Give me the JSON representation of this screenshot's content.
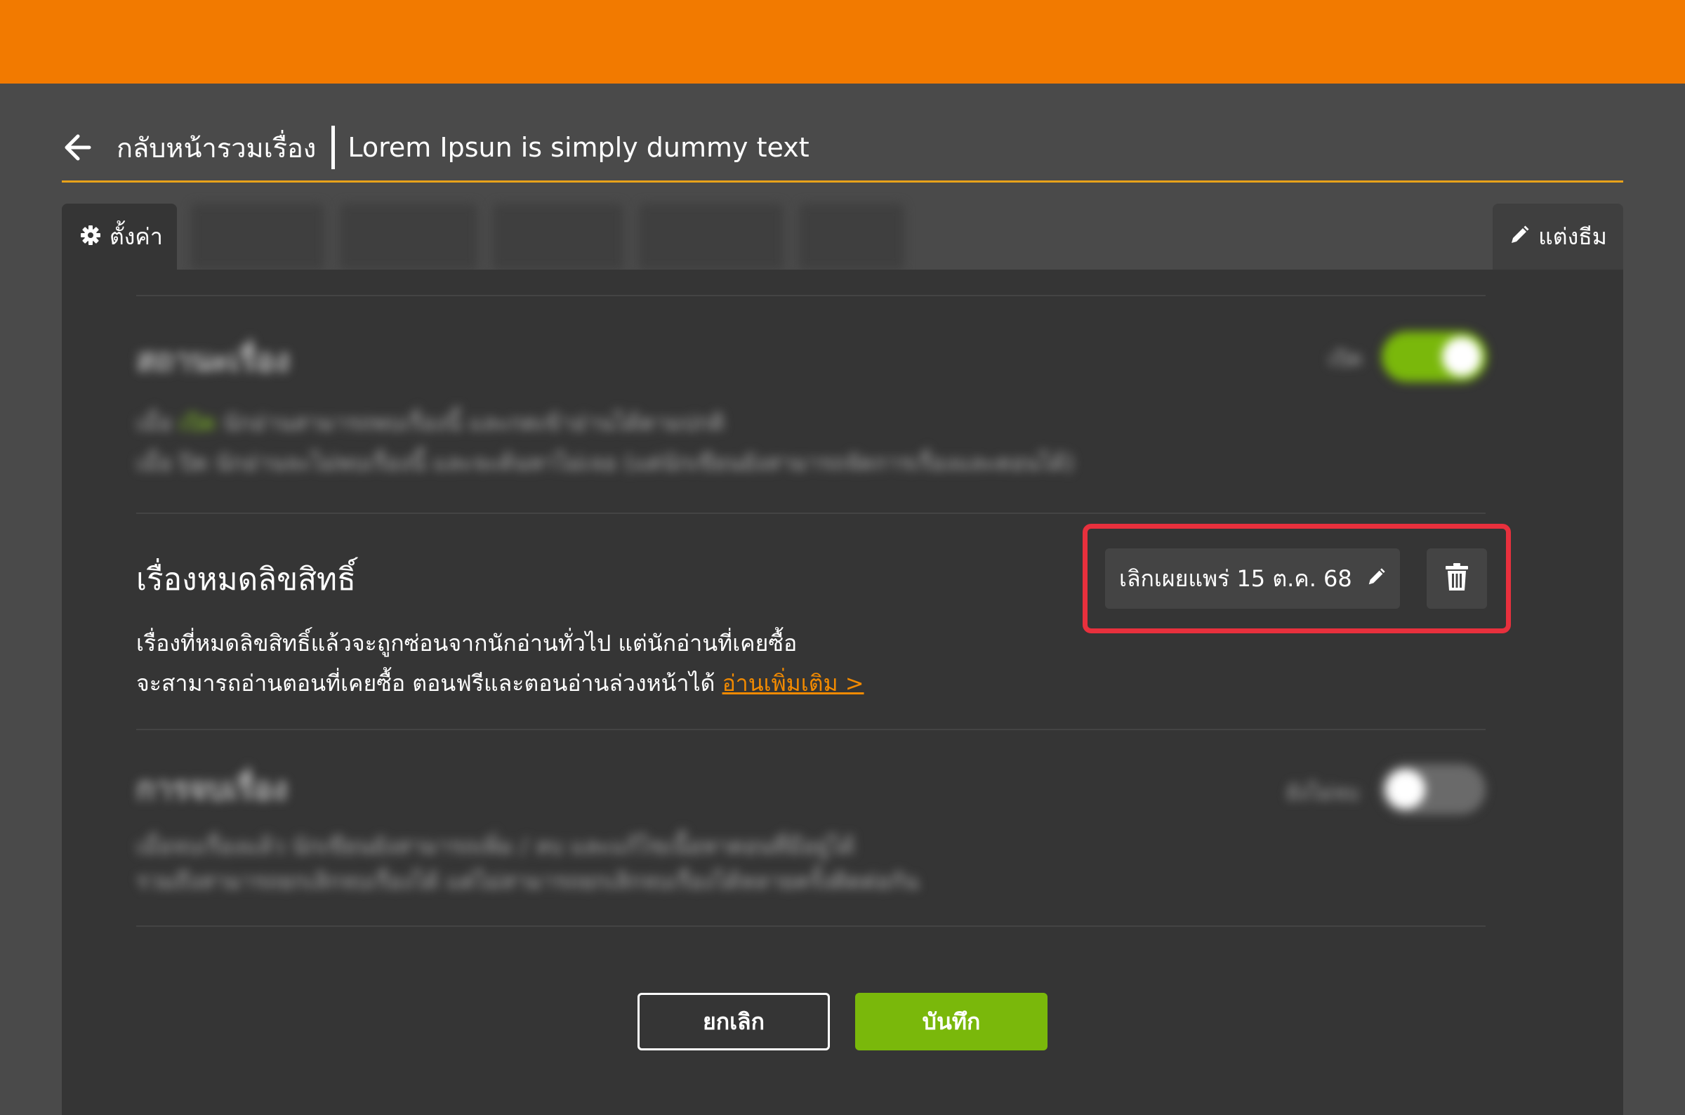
{
  "header": {
    "back_label": "กลับหน้ารวมเรื่อง",
    "title": "Lorem Ipsun is simply dummy text"
  },
  "tabs": {
    "settings_label": "ตั้งค่า",
    "theme_label": "แต่งธีม"
  },
  "sections": {
    "status": {
      "title": "สถานะเรื่อง",
      "toggle_label": "เปิด",
      "toggle_on": true,
      "desc_line1_prefix": "เมื่อ",
      "desc_line1_green": "เปิด",
      "desc_line1_rest": "นักอ่านสามารถพบเรื่องนี้ และกดเข้าอ่านได้ตามปกติ",
      "desc_line2": "เมื่อ ปิด นักอ่านจะไม่พบเรื่องนี้ และจะค้นหาไม่เจอ (แต่นักเขียนยังสามารถจัดการเรื่องและตอนได้)"
    },
    "copyright": {
      "title": "เรื่องหมดลิขสิทธิ์",
      "desc_line1": "เรื่องที่หมดลิขสิทธิ์แล้วจะถูกซ่อนจากนักอ่านทั่วไป แต่นักอ่านที่เคยซื้อ",
      "desc_line2": "จะสามารถอ่านตอนที่เคยซื้อ ตอนฟรีและตอนอ่านล่วงหน้าได้",
      "link": "อ่านเพิ่มเติม >",
      "date_value": "เลิกเผยแพร่ 15 ต.ค. 68"
    },
    "ending": {
      "title": "การจบเรื่อง",
      "toggle_label": "ยังไม่จบ",
      "toggle_on": false,
      "desc_line1": "เมื่อจบเรื่องแล้ว นักเขียนยังสามารถเพิ่ม / ลบ และแก้ไขเนื้อหาตอนที่มีอยู่ได้",
      "desc_line2": "รวมถึงสามารถยกเลิกจบเรื่องได้ แต่ไม่สามารถยกเลิกจบเรื่องได้หลายครั้งติดต่อกัน"
    }
  },
  "buttons": {
    "cancel": "ยกเลิก",
    "save": "บันทึก"
  },
  "colors": {
    "topbar": "#f27a00",
    "accent_line": "#e8a21a",
    "toggle_on": "#7ab80b",
    "highlight": "#e8303d",
    "link": "#f28a00"
  },
  "icons": [
    "back-arrow-icon",
    "gear-icon",
    "pencil-icon",
    "trash-icon"
  ]
}
